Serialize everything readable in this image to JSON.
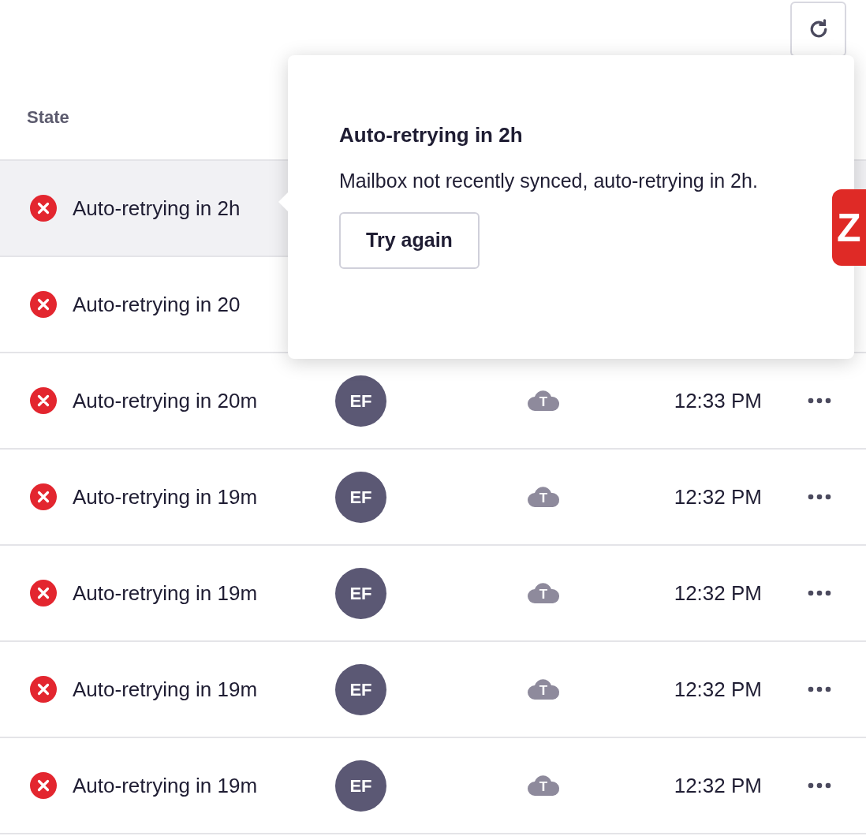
{
  "table": {
    "columns": [
      "State"
    ],
    "rows": [
      {
        "selected": true,
        "state": "Auto-retrying in 2h"
      },
      {
        "selected": false,
        "state": "Auto-retrying in 20"
      },
      {
        "selected": false,
        "state": "Auto-retrying in 20m",
        "avatar": "EF",
        "source": "T",
        "time": "12:33 PM"
      },
      {
        "selected": false,
        "state": "Auto-retrying in 19m",
        "avatar": "EF",
        "source": "T",
        "time": "12:32 PM"
      },
      {
        "selected": false,
        "state": "Auto-retrying in 19m",
        "avatar": "EF",
        "source": "T",
        "time": "12:32 PM"
      },
      {
        "selected": false,
        "state": "Auto-retrying in 19m",
        "avatar": "EF",
        "source": "T",
        "time": "12:32 PM"
      },
      {
        "selected": false,
        "state": "Auto-retrying in 19m",
        "avatar": "EF",
        "source": "T",
        "time": "12:32 PM"
      }
    ]
  },
  "popover": {
    "title": "Auto-retrying in 2h",
    "message": "Mailbox not recently synced, auto-retrying in 2h.",
    "button": "Try again"
  },
  "side_badge": "Z"
}
